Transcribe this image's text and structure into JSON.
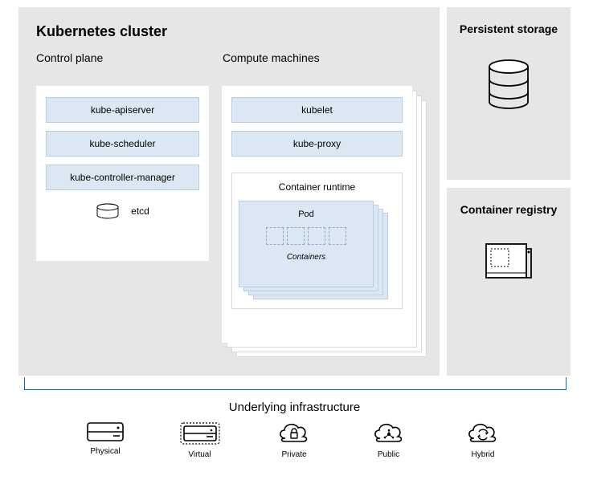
{
  "cluster": {
    "title": "Kubernetes cluster",
    "control_plane": {
      "heading": "Control plane",
      "items": [
        "kube-apiserver",
        "kube-scheduler",
        "kube-controller-manager"
      ],
      "etcd_label": "etcd"
    },
    "compute": {
      "heading": "Compute machines",
      "items": [
        "kubelet",
        "kube-proxy"
      ],
      "runtime": {
        "title": "Container runtime",
        "pod_title": "Pod",
        "containers_label": "Containers",
        "container_count": 4
      }
    }
  },
  "side": {
    "storage_title": "Persistent storage",
    "registry_title": "Container registry"
  },
  "infrastructure": {
    "title": "Underlying infrastructure",
    "items": [
      "Physical",
      "Virtual",
      "Private",
      "Public",
      "Hybrid"
    ]
  }
}
